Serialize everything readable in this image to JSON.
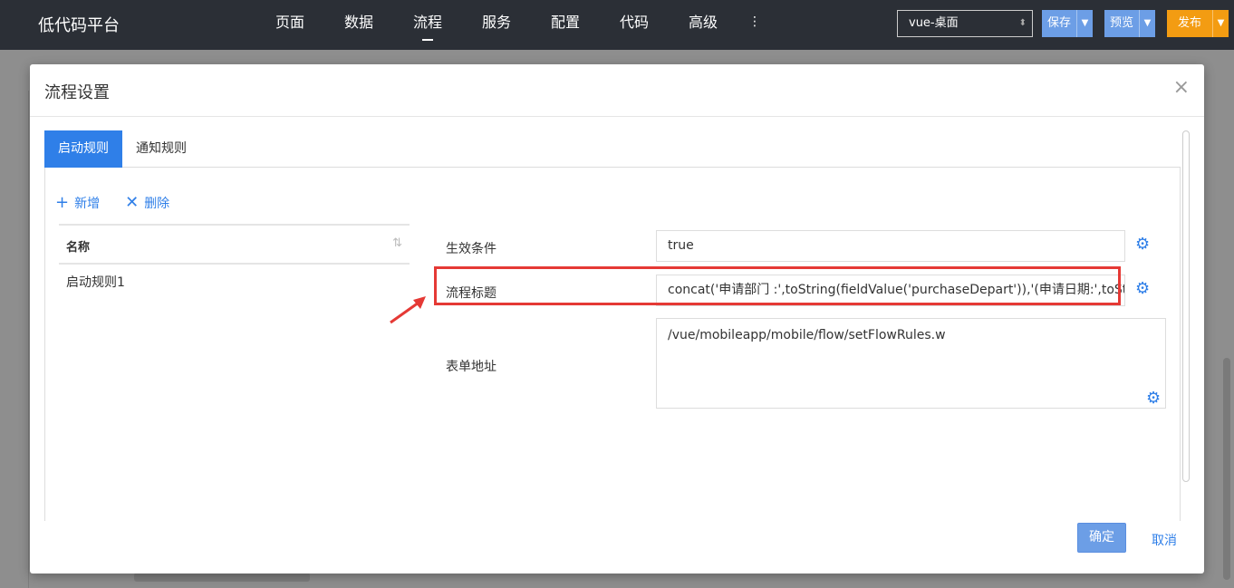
{
  "app": {
    "title": "低代码平台"
  },
  "nav": {
    "items": [
      {
        "label": "页面"
      },
      {
        "label": "数据"
      },
      {
        "label": "流程"
      },
      {
        "label": "服务"
      },
      {
        "label": "配置"
      },
      {
        "label": "代码"
      },
      {
        "label": "高级"
      }
    ],
    "more": "⋮"
  },
  "toolbar": {
    "env_value": "vue-桌面",
    "save_label": "保存",
    "preview_label": "预览",
    "publish_label": "发布"
  },
  "dialog": {
    "title": "流程设置",
    "tabs": [
      {
        "label": "启动规则",
        "active": true
      },
      {
        "label": "通知规则",
        "active": false
      }
    ],
    "actions": {
      "add_label": "新增",
      "delete_label": "删除"
    },
    "grid": {
      "column_header": "名称",
      "rows": [
        {
          "name": "启动规则1"
        }
      ]
    },
    "form": {
      "condition_label": "生效条件",
      "condition_value": "true",
      "title_label": "流程标题",
      "title_value": "concat('申请部门 :',toString(fieldValue('purchaseDepart')),'(申请日期:',toString(fieldValue('applyDate')),')')",
      "form_url_label": "表单地址",
      "form_url_value": "/vue/mobileapp/mobile/flow/setFlowRules.w"
    },
    "ok_label": "确定",
    "cancel_label": "取消"
  },
  "colors": {
    "accent": "#2f7fe8",
    "topbar": "#2b2f36",
    "publish": "#f39c12",
    "highlight": "#e53935"
  }
}
